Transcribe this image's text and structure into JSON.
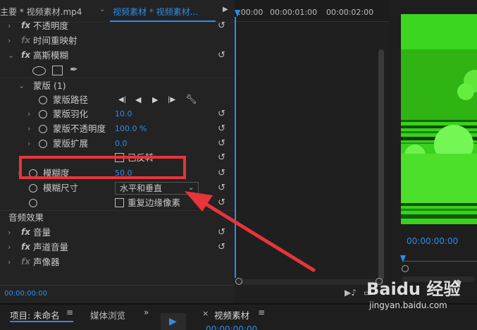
{
  "effects_panel": {
    "tab_source": "主要 * 视频素材.mp4",
    "tab_clip": "视频素材 * 视频素材...",
    "items": {
      "opacity": "不透明度",
      "time_remap": "时间重映射",
      "gaussian_blur": "高斯模糊",
      "mask": "蒙版 (1)",
      "mask_path": "蒙版路径",
      "mask_feather": "蒙版羽化",
      "mask_feather_value": "10.0",
      "mask_opacity": "蒙版不透明度",
      "mask_opacity_value": "100.0 %",
      "mask_expansion": "蒙版扩展",
      "mask_expansion_value": "0.0",
      "inverted": "已反转",
      "blurriness": "模糊度",
      "blurriness_value": "50.0",
      "blur_dimensions": "模糊尺寸",
      "blur_dimensions_value": "水平和垂直",
      "repeat_edge_pixels": "重复边缘像素",
      "audio_effects": "音频效果",
      "volume": "音量",
      "channel_volume": "声道音量",
      "panner": "声像器"
    },
    "timecode": "00:00:00:00"
  },
  "timeline": {
    "ruler_labels": [
      ":00:00",
      "00:00:01:00",
      "00:00:02:00"
    ]
  },
  "program_monitor": {
    "timecode": "00:00:00:00"
  },
  "bottom_bar": {
    "project_tab": "项目: 未命名",
    "media_browser_tab": "媒体浏览",
    "sequence_tab": "视频素材",
    "sequence_timecode": "00:00:00:00"
  },
  "watermark": {
    "brand": "Baidu 经验",
    "url": "jingyan.baidu.com"
  },
  "colors": {
    "accent_blue": "#2d8ceb",
    "highlight_red": "#e8343a",
    "video_green": "#39d11d"
  }
}
